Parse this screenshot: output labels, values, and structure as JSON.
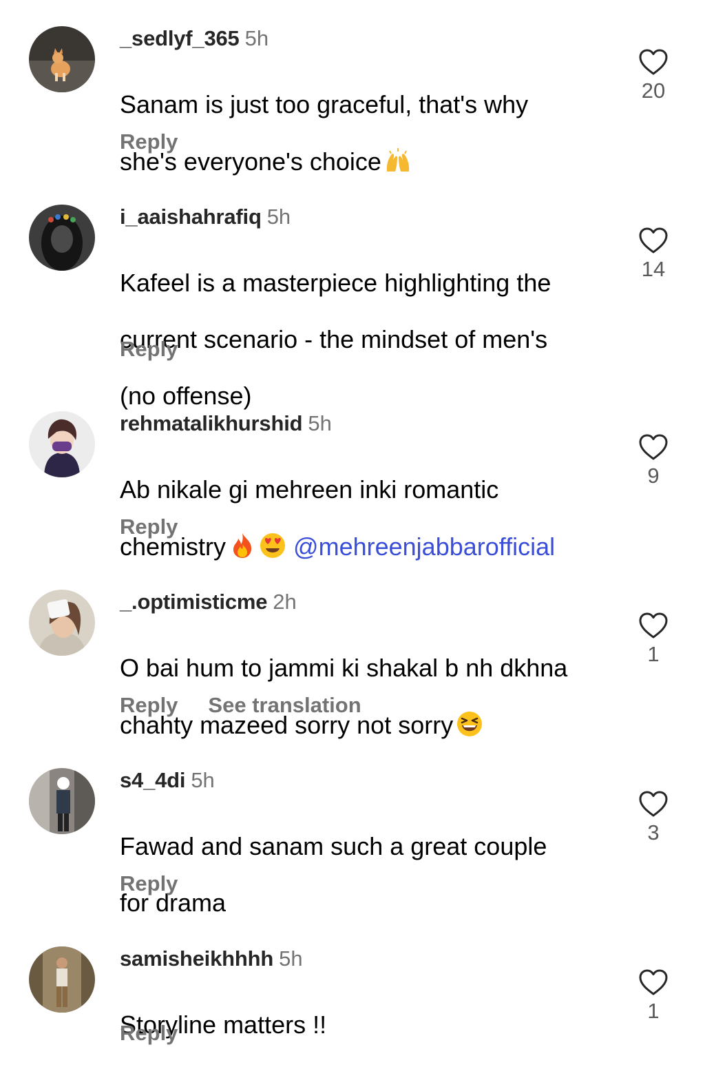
{
  "comments": [
    {
      "username": "_sedlyf_365",
      "time": "5h",
      "lines": [
        "Sanam is just too graceful, that's why",
        "she's everyone's choice"
      ],
      "emoji": [
        "raising-hands"
      ],
      "reply": "Reply",
      "likes": "20"
    },
    {
      "username": "i_aaishahrafiq",
      "time": "5h",
      "lines": [
        "Kafeel is a masterpiece highlighting the",
        "current scenario - the mindset of men's",
        "(no offense)"
      ],
      "reply": "Reply",
      "likes": "14"
    },
    {
      "username": "rehmatalikhurshid",
      "time": "5h",
      "lines": [
        "Ab nikale gi mehreen inki romantic",
        "chemistry"
      ],
      "emoji": [
        "fire",
        "heart-eyes"
      ],
      "mention": "@mehreenjabbarofficial",
      "reply": "Reply",
      "likes": "9"
    },
    {
      "username": "_.optimisticme",
      "time": "2h",
      "lines": [
        "O bai hum to jammi ki shakal b nh dkhna",
        "chahty mazeed sorry not sorry"
      ],
      "emoji": [
        "grinning-squinting"
      ],
      "reply": "Reply",
      "see_translation": "See translation",
      "likes": "1"
    },
    {
      "username": "s4_4di",
      "time": "5h",
      "lines": [
        "Fawad and sanam such a great couple",
        "for drama"
      ],
      "reply": "Reply",
      "likes": "3"
    },
    {
      "username": "samisheikhhhh",
      "time": "5h",
      "lines": [
        "Storyline matters !!"
      ],
      "reply": "Reply",
      "likes": "1"
    }
  ],
  "colors": {
    "username": "#262626",
    "meta": "#737373",
    "mention": "#3a4ed8",
    "heart_outline": "#262626"
  }
}
